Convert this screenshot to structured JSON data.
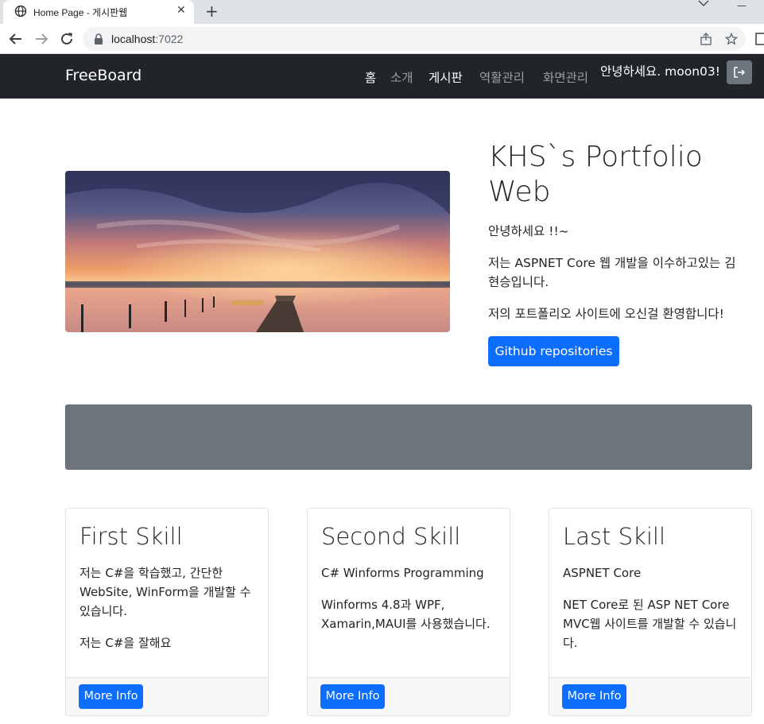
{
  "browser": {
    "tab_title": "Home Page - 게시판웹",
    "url_host": "localhost",
    "url_port": ":7022"
  },
  "navbar": {
    "brand": "FreeBoard",
    "links": [
      {
        "label": "홈",
        "active": true
      },
      {
        "label": "소개",
        "active": false
      },
      {
        "label": "게시판",
        "active": true
      },
      {
        "label": "역활관리",
        "active": false
      },
      {
        "label": "화면관리",
        "active": false
      }
    ],
    "greeting": "안녕하세요. moon03!"
  },
  "hero": {
    "title": "KHS`s Portfolio Web",
    "paragraphs": [
      "안녕하세요 !!~",
      "저는 ASPNET Core 웹 개발을 이수하고있는 김현승입니다.",
      "저의 포트폴리오 사이트에 오신걸 환영합니다!"
    ],
    "button": "Github repositories"
  },
  "cards": [
    {
      "title": "First Skill",
      "paragraphs": [
        "저는 C#을 학습했고, 간단한 WebSite, WinForm을 개발할 수 있습니다.",
        "저는 C#을 잘해요"
      ],
      "button": "More Info"
    },
    {
      "title": "Second Skill",
      "paragraphs": [
        "C# Winforms Programming",
        "Winforms 4.8과 WPF, Xamarin,MAUI를 사용했습니다."
      ],
      "button": "More Info"
    },
    {
      "title": "Last Skill",
      "paragraphs": [
        "ASPNET Core",
        "NET Core로 된 ASP NET Core MVC웹 사이트를 개발할 수 있습니다."
      ],
      "button": "More Info"
    }
  ],
  "colors": {
    "navbar_bg": "#212529",
    "primary": "#0d6efd",
    "banner": "#6c757d"
  }
}
